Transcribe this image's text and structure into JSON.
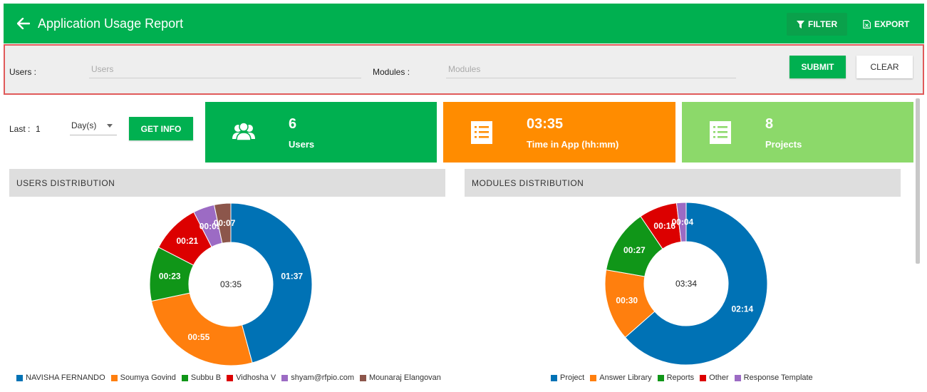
{
  "header": {
    "title": "Application Usage Report",
    "filter_label": "FILTER",
    "export_label": "EXPORT"
  },
  "filters": {
    "users_label": "Users :",
    "users_placeholder": "Users",
    "modules_label": "Modules :",
    "modules_placeholder": "Modules",
    "submit_label": "SUBMIT",
    "clear_label": "CLEAR"
  },
  "range": {
    "last_label": "Last :",
    "last_value": "1",
    "unit": "Day(s)",
    "get_info_label": "GET INFO"
  },
  "cards": [
    {
      "value": "6",
      "label": "Users",
      "color": "#00b050",
      "icon": "users-icon"
    },
    {
      "value": "03:35",
      "label": "Time in App (hh:mm)",
      "color": "#ff8c00",
      "icon": "list-icon"
    },
    {
      "value": "8",
      "label": "Projects",
      "color": "#8cd96a",
      "icon": "list-icon"
    }
  ],
  "panels": {
    "users_title": "USERS DISTRIBUTION",
    "modules_title": "MODULES DISTRIBUTION"
  },
  "chart_data": [
    {
      "type": "pie",
      "title": "USERS DISTRIBUTION",
      "center_label": "03:35",
      "series": [
        {
          "name": "NAVISHA FERNANDO",
          "value": 97,
          "label": "01:37",
          "color": "#0072b5"
        },
        {
          "name": "Soumya Govind",
          "value": 55,
          "label": "00:55",
          "color": "#ff7f0e"
        },
        {
          "name": "Subbu B",
          "value": 23,
          "label": "00:23",
          "color": "#109618"
        },
        {
          "name": "Vidhosha V",
          "value": 21,
          "label": "00:21",
          "color": "#dc0000"
        },
        {
          "name": "shyam@rfpio.com",
          "value": 9,
          "label": "00:09",
          "color": "#9c6bc4"
        },
        {
          "name": "Mounaraj Elangovan",
          "value": 7,
          "label": "00:07",
          "color": "#8c564b"
        }
      ]
    },
    {
      "type": "pie",
      "title": "MODULES DISTRIBUTION",
      "center_label": "03:34",
      "series": [
        {
          "name": "Project",
          "value": 134,
          "label": "02:14",
          "color": "#0072b5"
        },
        {
          "name": "Answer Library",
          "value": 30,
          "label": "00:30",
          "color": "#ff7f0e"
        },
        {
          "name": "Reports",
          "value": 27,
          "label": "00:27",
          "color": "#109618"
        },
        {
          "name": "Other",
          "value": 16,
          "label": "00:16",
          "color": "#dc0000"
        },
        {
          "name": "Response Template",
          "value": 4,
          "label": "00:04",
          "color": "#9c6bc4"
        }
      ]
    }
  ]
}
